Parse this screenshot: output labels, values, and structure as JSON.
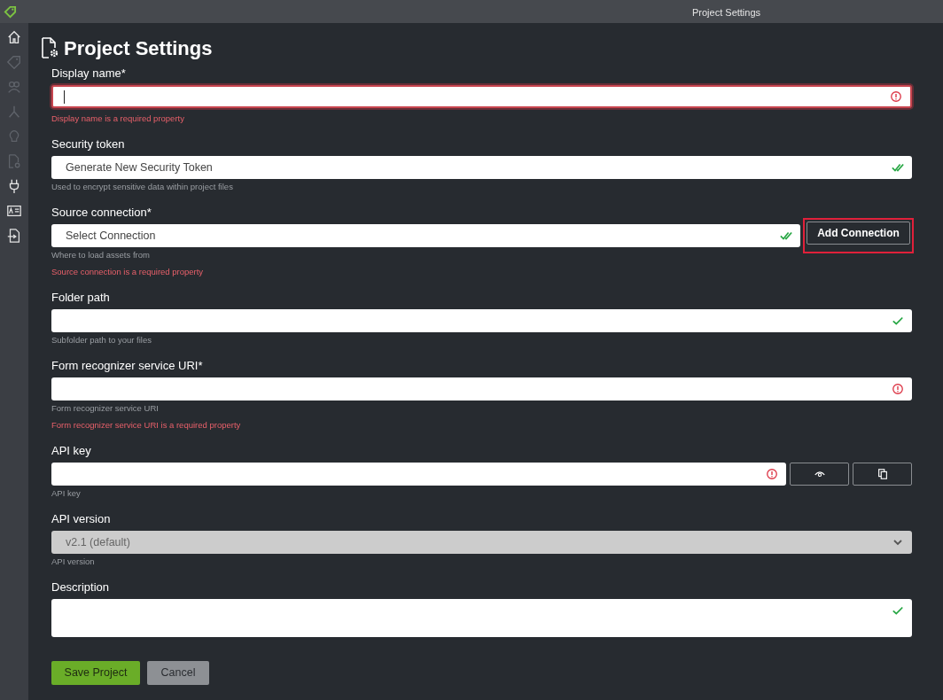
{
  "window": {
    "title": "Project Settings"
  },
  "sidebar": {
    "items": [
      {
        "disabled": false
      },
      {
        "disabled": true
      },
      {
        "disabled": true
      },
      {
        "disabled": true
      },
      {
        "disabled": true
      },
      {
        "disabled": true
      },
      {
        "disabled": false
      },
      {
        "disabled": false
      },
      {
        "disabled": false
      }
    ]
  },
  "page": {
    "title": "Project Settings"
  },
  "fields": [
    {
      "kind": "text",
      "label": "Display name*",
      "focused": true,
      "valid": false,
      "error": "Display name is a required property"
    },
    {
      "kind": "select",
      "label": "Security token",
      "value": "Generate New Security Token",
      "valid": true,
      "double_check": true,
      "help": "Used to encrypt sensitive data within project files"
    },
    {
      "kind": "select",
      "label": "Source connection*",
      "value": "Select Connection",
      "valid": true,
      "double_check": true,
      "help": "Where to load assets from",
      "error": "Source connection is a required property",
      "button": {
        "label": "Add Connection",
        "highlighted": true
      }
    },
    {
      "kind": "text",
      "label": "Folder path",
      "valid": true,
      "double_check": false,
      "help": "Subfolder path to your files"
    },
    {
      "kind": "text",
      "label": "Form recognizer service URI*",
      "valid": false,
      "help": "Form recognizer service URI",
      "error": "Form recognizer service URI is a required property"
    },
    {
      "kind": "secret",
      "label": "API key",
      "valid": false,
      "help": "API key"
    },
    {
      "kind": "dropdown",
      "label": "API version",
      "value": "v2.1 (default)",
      "disabled": true,
      "help": "API version"
    },
    {
      "kind": "textarea",
      "label": "Description",
      "valid": true,
      "double_check": false
    }
  ],
  "buttons": [
    {
      "label": "Save Project",
      "kind": "primary"
    },
    {
      "label": "Cancel",
      "kind": "secondary"
    }
  ]
}
